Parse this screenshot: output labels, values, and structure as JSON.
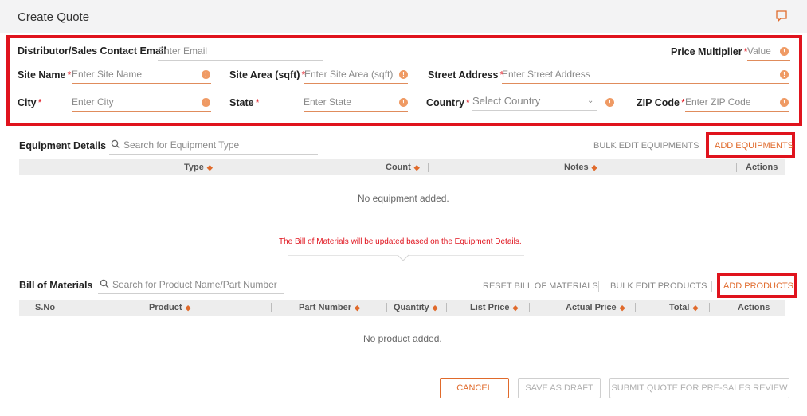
{
  "window": {
    "title": "Create Quote",
    "chat_icon": "chat-icon"
  },
  "form": {
    "email_label": "Distributor/Sales Contact Email",
    "email_placeholder": "Enter Email",
    "multiplier_label": "Price Multiplier",
    "multiplier_placeholder": "Value",
    "site_name_label": "Site Name",
    "site_name_placeholder": "Enter Site Name",
    "site_area_label": "Site Area (sqft)",
    "site_area_placeholder": "Enter Site Area (sqft)",
    "street_label": "Street Address",
    "street_placeholder": "Enter Street Address",
    "city_label": "City",
    "city_placeholder": "Enter City",
    "state_label": "State",
    "state_placeholder": "Enter State",
    "country_label": "Country",
    "country_placeholder": "Select Country",
    "zip_label": "ZIP Code",
    "zip_placeholder": "Enter ZIP Code",
    "required_mark": "*",
    "info_glyph": "!"
  },
  "equipment": {
    "title": "Equipment Details",
    "search_placeholder": "Search for Equipment Type",
    "bulk_edit": "BULK EDIT EQUIPMENTS",
    "add": "ADD EQUIPMENTS",
    "columns": [
      "Type",
      "Count",
      "Notes",
      "Actions"
    ],
    "empty": "No equipment added.",
    "notice": "The Bill of Materials will be updated based on the Equipment Details."
  },
  "bom": {
    "title": "Bill of Materials",
    "search_placeholder": "Search for Product Name/Part Number",
    "reset": "RESET BILL OF MATERIALS",
    "bulk_edit": "BULK EDIT PRODUCTS",
    "add": "ADD PRODUCTS",
    "columns": [
      "S.No",
      "Product",
      "Part Number",
      "Quantity",
      "List Price",
      "Actual Price",
      "Total",
      "Actions"
    ],
    "empty": "No product added."
  },
  "actions": {
    "cancel": "CANCEL",
    "save_draft": "SAVE AS DRAFT",
    "submit": "SUBMIT QUOTE FOR PRE-SALES REVIEW"
  },
  "colors": {
    "accent": "#e06a2b",
    "highlight": "#e0131d",
    "header_bg": "#ededed"
  }
}
